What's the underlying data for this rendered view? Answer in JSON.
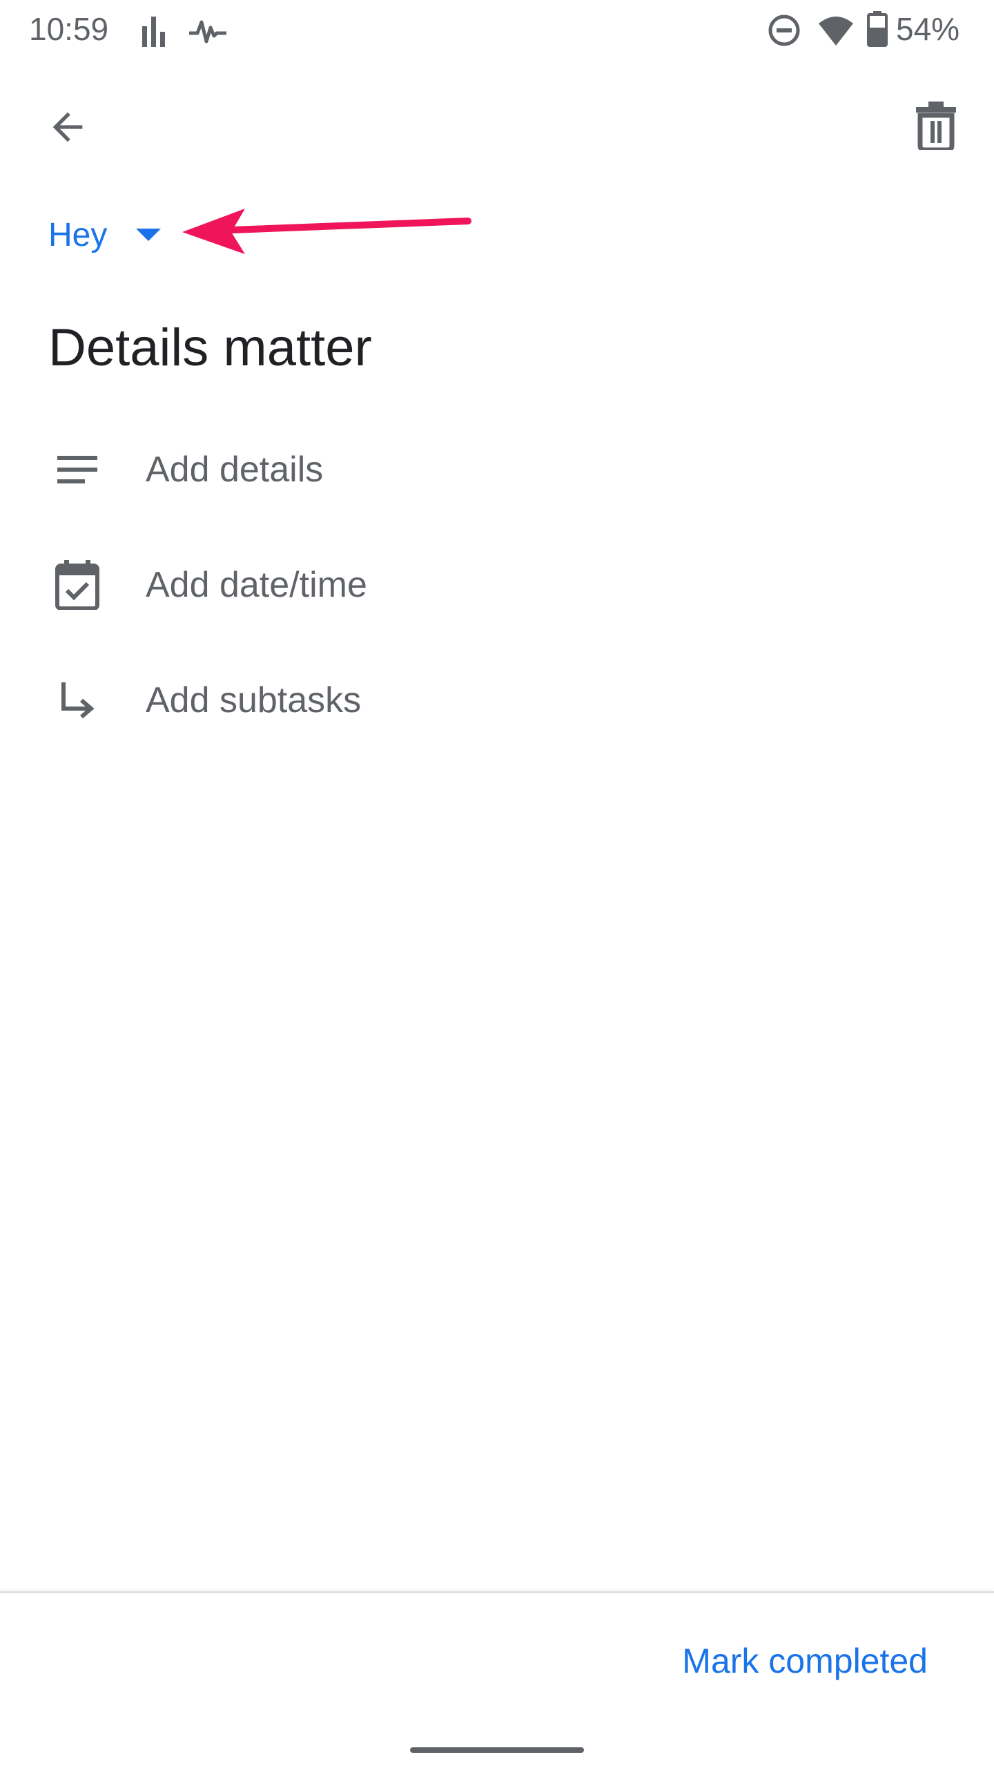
{
  "status_bar": {
    "time": "10:59",
    "battery": "54%",
    "icons": [
      "signal-bars-icon",
      "activity-wave-icon",
      "do-not-disturb-icon",
      "wifi-icon",
      "battery-icon"
    ]
  },
  "app_bar": {
    "back_icon": "arrow-back-icon",
    "delete_icon": "trash-icon"
  },
  "list_selector": {
    "value": "Hey",
    "icon": "dropdown-caret-icon"
  },
  "annotation": {
    "icon": "red-arrow-annotation",
    "color": "#f0145a"
  },
  "task": {
    "title": "Details matter"
  },
  "actions": [
    {
      "label": "Add details",
      "icon": "notes-icon"
    },
    {
      "label": "Add date/time",
      "icon": "calendar-check-icon"
    },
    {
      "label": "Add subtasks",
      "icon": "subdirectory-arrow-icon"
    }
  ],
  "footer": {
    "mark_completed_label": "Mark completed"
  },
  "colors": {
    "accent": "#1a73e8",
    "icon_gray": "#5f6368",
    "title": "#202124"
  }
}
